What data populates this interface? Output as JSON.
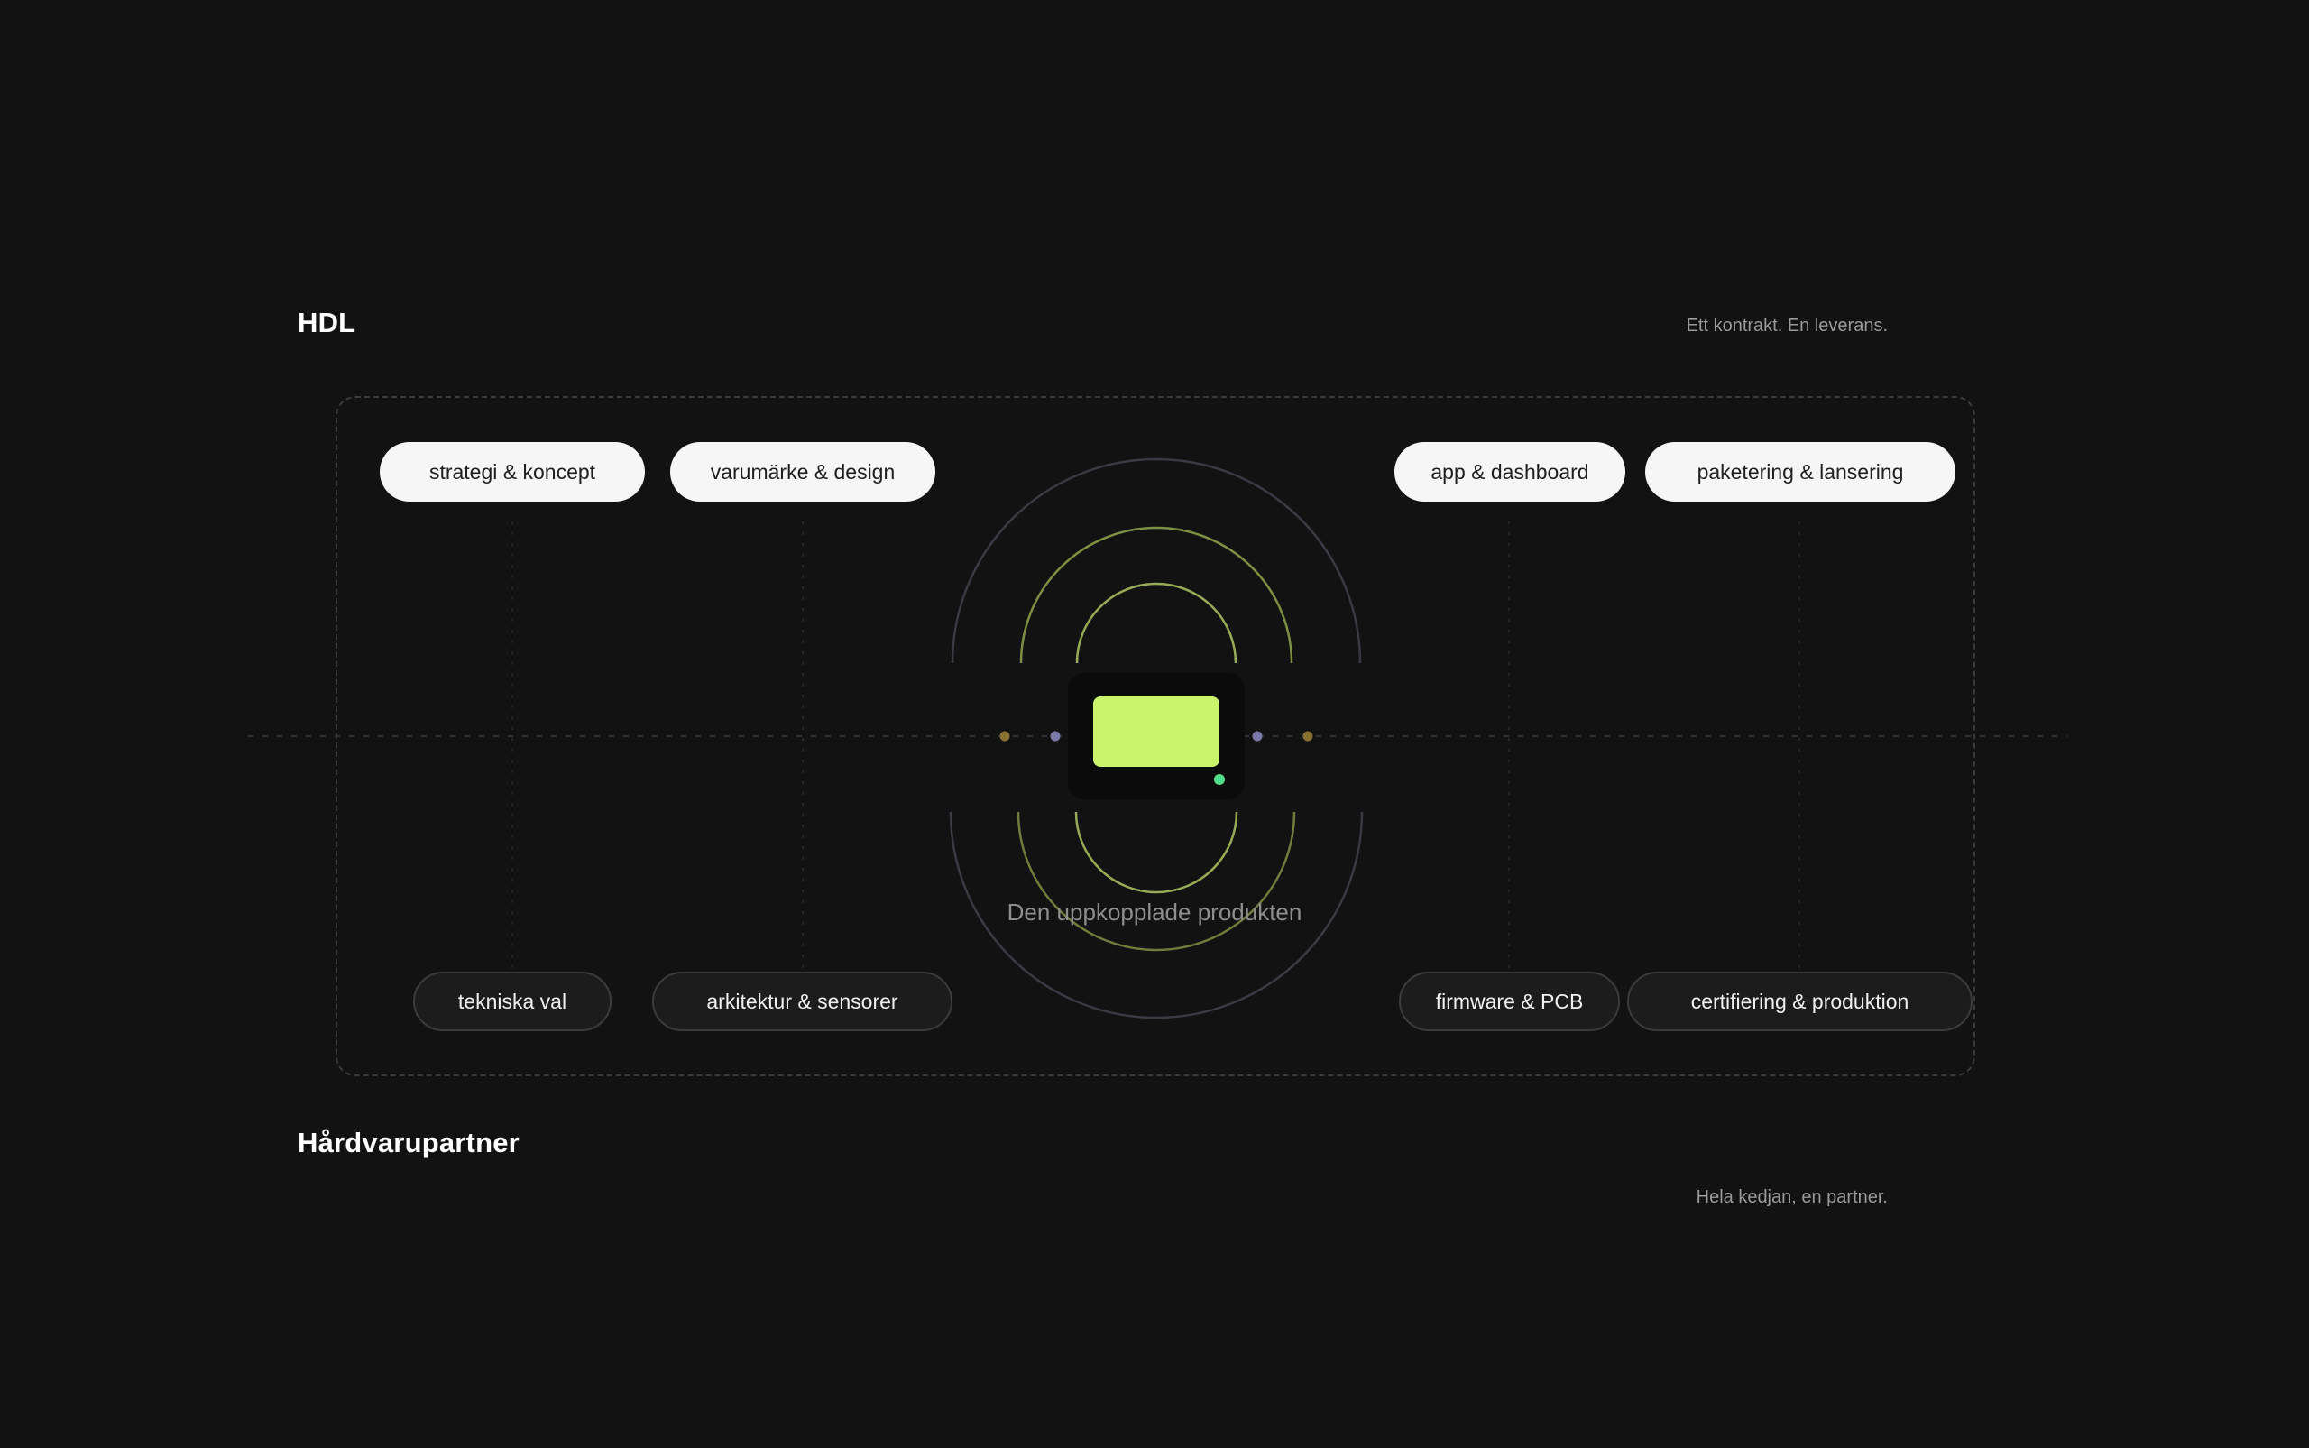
{
  "header": {
    "brand": "HDL",
    "tagline": "Ett kontrakt. En leverans."
  },
  "top_pills": [
    {
      "label": "strategi & koncept"
    },
    {
      "label": "varumärke & design"
    },
    {
      "label": "app & dashboard"
    },
    {
      "label": "paketering & lansering"
    }
  ],
  "bottom_pills": [
    {
      "label": "tekniska val"
    },
    {
      "label": "arkitektur & sensorer"
    },
    {
      "label": "firmware & PCB"
    },
    {
      "label": "certifiering & produktion"
    }
  ],
  "center": {
    "caption": "Den uppkopplade produkten"
  },
  "footer": {
    "title": "Hårdvarupartner",
    "tagline": "Hela kedjan, en partner."
  },
  "colors": {
    "background": "#121212",
    "accent_lime": "#c8f56a",
    "status_green": "#4ee08a",
    "dot_purple": "#7b79a8",
    "dot_amber": "#8a7033",
    "ring_olive": "#8c9f4a",
    "ring_gray": "#3a3a44"
  },
  "icons": {
    "device": "device-screen-icon",
    "status": "status-dot-icon"
  }
}
